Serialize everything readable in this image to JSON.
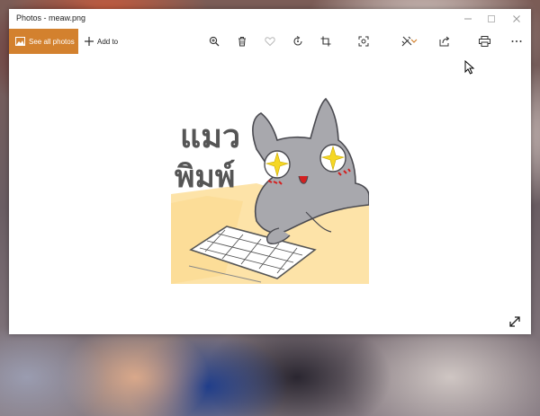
{
  "window": {
    "title": "Photos - meaw.png",
    "controls": {
      "minimize_icon": "minimize-icon",
      "maximize_icon": "maximize-icon",
      "close_icon": "close-icon"
    }
  },
  "toolbar": {
    "see_all_photos": "See all photos",
    "add_to": "Add to",
    "accent": "#d3812e",
    "buttons": [
      "zoom-icon",
      "delete-icon",
      "favorite-icon",
      "rotate-icon",
      "crop-icon",
      "enhance-icon",
      "edit-icon",
      "share-icon",
      "print-icon",
      "more-icon"
    ]
  },
  "image": {
    "handwriting_line1": "แมว",
    "handwriting_line2": "พิมพ์"
  }
}
